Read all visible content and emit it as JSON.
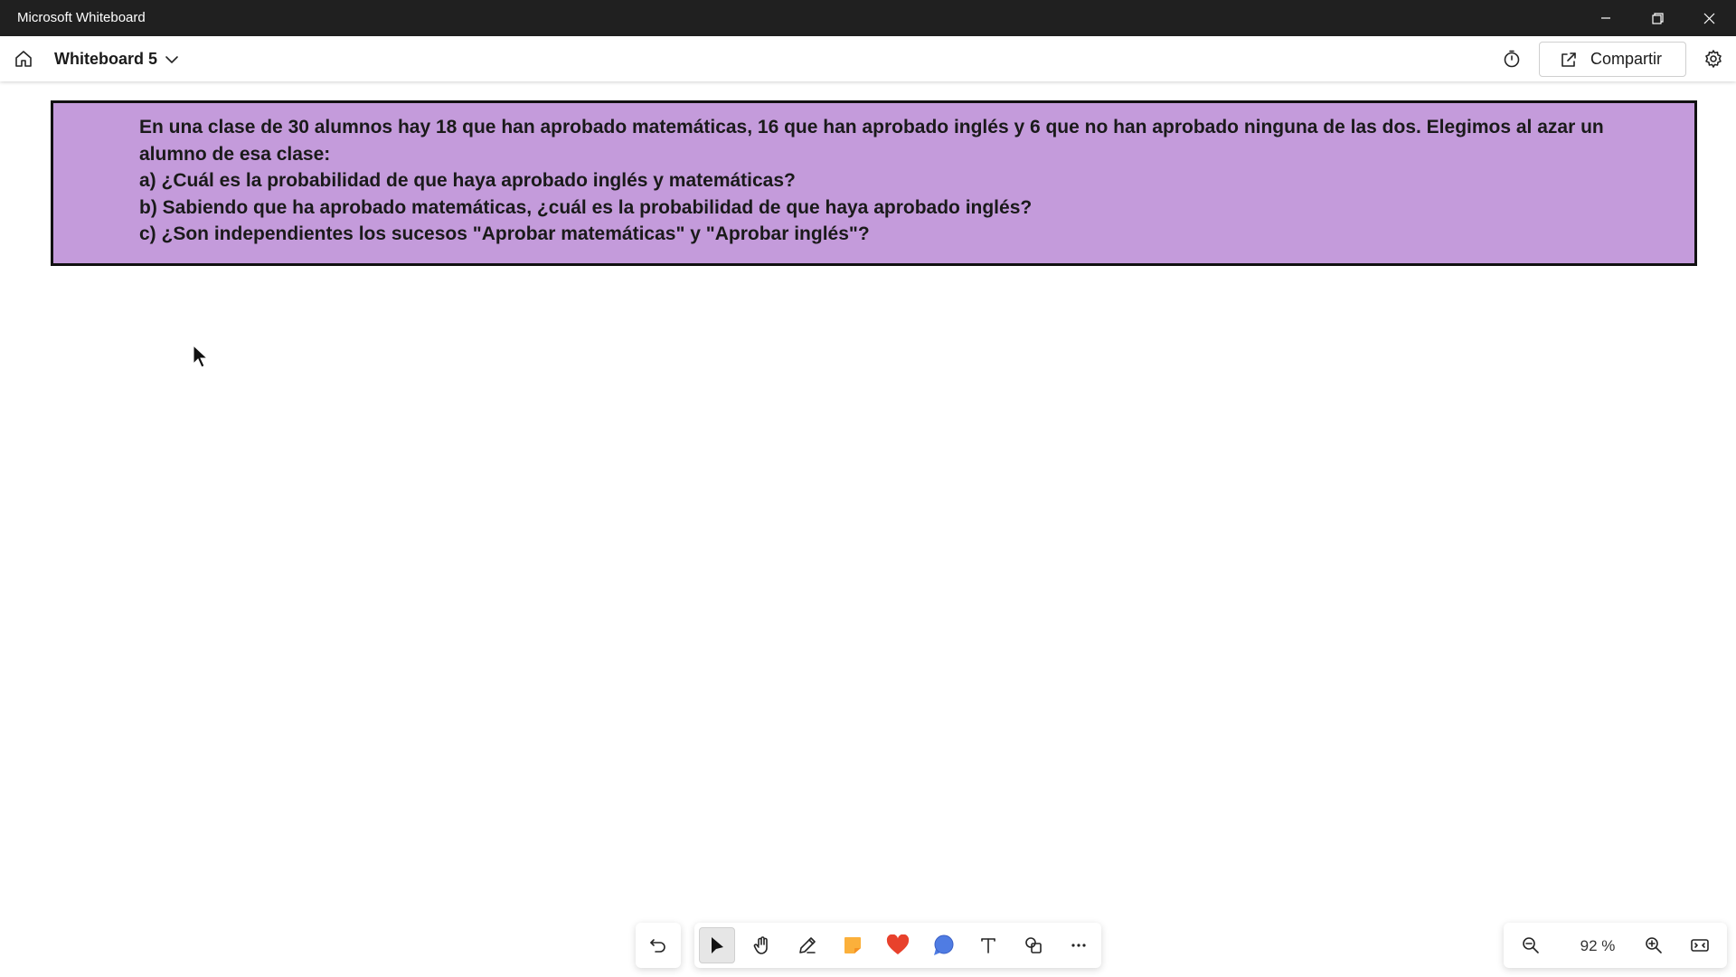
{
  "window": {
    "title": "Microsoft Whiteboard",
    "controls": [
      "minimize-icon",
      "restore-icon",
      "close-icon"
    ]
  },
  "header": {
    "board_name": "Whiteboard 5",
    "share_label": "Compartir"
  },
  "canvas": {
    "note": {
      "background": "#c49bdb",
      "lines": [
        "En una clase de 30 alumnos hay 18 que han aprobado matemáticas, 16 que han aprobado inglés y 6 que no han aprobado ninguna de las dos. Elegimos al azar un",
        "alumno de esa clase:",
        "a) ¿Cuál es la probabilidad de que haya aprobado inglés y matemáticas?",
        "b) Sabiendo que ha aprobado matemáticas, ¿cuál es la probabilidad de que haya aprobado inglés?",
        "c) ¿Son independientes los sucesos \"Aprobar matemáticas\" y \"Aprobar inglés\"?"
      ]
    }
  },
  "toolbar": {
    "tools": [
      "undo-icon",
      "select-icon",
      "pan-hand-icon",
      "pen-icon",
      "sticky-note-icon",
      "reaction-heart-icon",
      "comment-icon",
      "text-icon",
      "shapes-icon",
      "more-icon"
    ],
    "active_tool": "select"
  },
  "zoom": {
    "level": "92 %"
  }
}
